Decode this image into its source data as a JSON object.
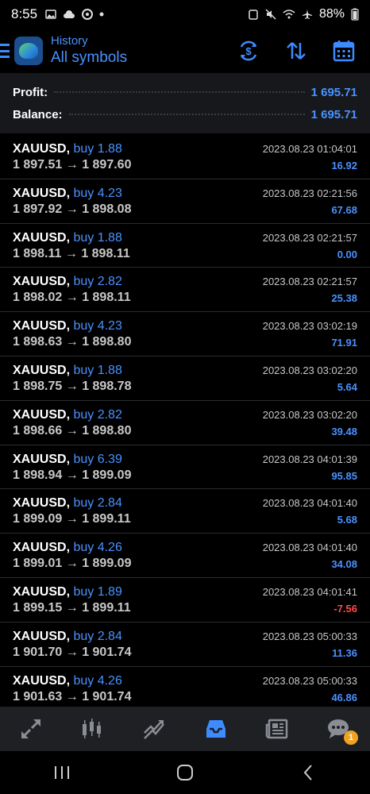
{
  "status": {
    "time": "8:55",
    "battery": "88%"
  },
  "header": {
    "subtitle": "History",
    "title": "All symbols"
  },
  "summary": {
    "profit_label": "Profit:",
    "profit_value": "1 695.71",
    "balance_label": "Balance:",
    "balance_value": "1 695.71"
  },
  "trades": [
    {
      "symbol": "XAUUSD,",
      "side": "buy 1.88",
      "open": "1 897.51",
      "close": "1 897.60",
      "time": "2023.08.23 01:04:01",
      "profit": "16.92",
      "sign": "pos"
    },
    {
      "symbol": "XAUUSD,",
      "side": "buy 4.23",
      "open": "1 897.92",
      "close": "1 898.08",
      "time": "2023.08.23 02:21:56",
      "profit": "67.68",
      "sign": "pos"
    },
    {
      "symbol": "XAUUSD,",
      "side": "buy 1.88",
      "open": "1 898.11",
      "close": "1 898.11",
      "time": "2023.08.23 02:21:57",
      "profit": "0.00",
      "sign": "pos"
    },
    {
      "symbol": "XAUUSD,",
      "side": "buy 2.82",
      "open": "1 898.02",
      "close": "1 898.11",
      "time": "2023.08.23 02:21:57",
      "profit": "25.38",
      "sign": "pos"
    },
    {
      "symbol": "XAUUSD,",
      "side": "buy 4.23",
      "open": "1 898.63",
      "close": "1 898.80",
      "time": "2023.08.23 03:02:19",
      "profit": "71.91",
      "sign": "pos"
    },
    {
      "symbol": "XAUUSD,",
      "side": "buy 1.88",
      "open": "1 898.75",
      "close": "1 898.78",
      "time": "2023.08.23 03:02:20",
      "profit": "5.64",
      "sign": "pos"
    },
    {
      "symbol": "XAUUSD,",
      "side": "buy 2.82",
      "open": "1 898.66",
      "close": "1 898.80",
      "time": "2023.08.23 03:02:20",
      "profit": "39.48",
      "sign": "pos"
    },
    {
      "symbol": "XAUUSD,",
      "side": "buy 6.39",
      "open": "1 898.94",
      "close": "1 899.09",
      "time": "2023.08.23 04:01:39",
      "profit": "95.85",
      "sign": "pos"
    },
    {
      "symbol": "XAUUSD,",
      "side": "buy 2.84",
      "open": "1 899.09",
      "close": "1 899.11",
      "time": "2023.08.23 04:01:40",
      "profit": "5.68",
      "sign": "pos"
    },
    {
      "symbol": "XAUUSD,",
      "side": "buy 4.26",
      "open": "1 899.01",
      "close": "1 899.09",
      "time": "2023.08.23 04:01:40",
      "profit": "34.08",
      "sign": "pos"
    },
    {
      "symbol": "XAUUSD,",
      "side": "buy 1.89",
      "open": "1 899.15",
      "close": "1 899.11",
      "time": "2023.08.23 04:01:41",
      "profit": "-7.56",
      "sign": "neg"
    },
    {
      "symbol": "XAUUSD,",
      "side": "buy 2.84",
      "open": "1 901.70",
      "close": "1 901.74",
      "time": "2023.08.23 05:00:33",
      "profit": "11.36",
      "sign": "pos"
    },
    {
      "symbol": "XAUUSD,",
      "side": "buy 4.26",
      "open": "1 901.63",
      "close": "1 901.74",
      "time": "2023.08.23 05:00:33",
      "profit": "46.86",
      "sign": "pos"
    }
  ],
  "arrow": "→",
  "bottom_nav": {
    "items": [
      "quotes-icon",
      "chart-icon",
      "trade-icon",
      "history-icon",
      "news-icon",
      "chat-icon"
    ],
    "active": "history-icon",
    "chat_badge": "1"
  },
  "colors": {
    "accent": "#3d8bff",
    "negative": "#ff4a4a",
    "badge": "#f2a221"
  }
}
